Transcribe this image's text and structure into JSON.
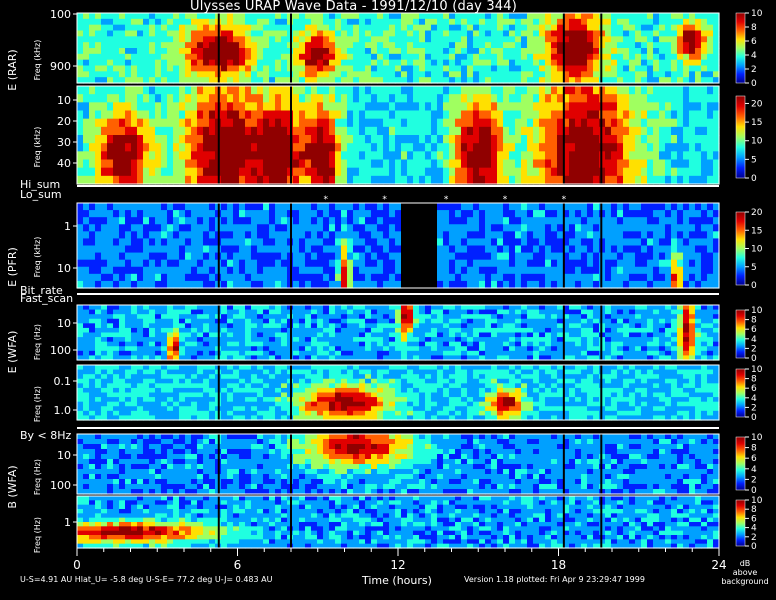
{
  "title": "Ulysses URAP Wave Data - 1991/12/10  (day 344)",
  "x_axis": {
    "label": "Time (hours)",
    "range": [
      0,
      24
    ],
    "ticks": [
      "0",
      "6",
      "12",
      "18",
      "24"
    ]
  },
  "footer": {
    "left": "U-S=4.91 AU  Hlat_U= -5.8 deg  U-S-E= 77.2 deg  U-J= 0.483 AU",
    "right": "Version 1.18 plotted: Fri Apr  9 23:29:47 1999",
    "colorbar_unit": [
      "dB",
      "above",
      "background"
    ]
  },
  "colors": {
    "background": "#000000",
    "text": "#ffffff",
    "colormap": [
      "#00008f",
      "#0020ff",
      "#00a0ff",
      "#20ffe0",
      "#a0ff60",
      "#ffe000",
      "#ff6000",
      "#e00000",
      "#900000"
    ]
  },
  "chart_data": [
    {
      "type": "heatmap",
      "panel": "E (RAR)",
      "ylabel": "E (RAR)",
      "yunit": "Freq (kHz)",
      "yticks": [
        "100",
        "900"
      ],
      "yscale": "log",
      "colorbar_ticks": [
        "0",
        "2",
        "4",
        "6",
        "8",
        "10"
      ],
      "colorbar_range": [
        0,
        10
      ]
    },
    {
      "type": "heatmap",
      "panel": "E (RAR) low band",
      "yunit": "Freq (kHz)",
      "yticks": [
        "10",
        "20",
        "30",
        "40"
      ],
      "yscale": "linear",
      "colorbar_ticks": [
        "0",
        "5",
        "10",
        "15",
        "20"
      ],
      "colorbar_range": [
        0,
        22
      ]
    },
    {
      "type": "heatmap",
      "panel": "E (PFR)",
      "ylabel": "E (PFR)",
      "yunit": "Freq (kHz)",
      "yticks": [
        "1",
        "10"
      ],
      "yscale": "log",
      "colorbar_ticks": [
        "0",
        "5",
        "10",
        "15",
        "20"
      ],
      "colorbar_range": [
        0,
        20
      ]
    },
    {
      "type": "heatmap",
      "panel": "E (WFA) high",
      "ylabel": "E (WFA)",
      "yunit": "Freq (Hz)",
      "yticks": [
        "10",
        "100"
      ],
      "yscale": "log",
      "colorbar_ticks": [
        "0",
        "2",
        "4",
        "6",
        "8",
        "10"
      ],
      "colorbar_range": [
        0,
        10
      ]
    },
    {
      "type": "heatmap",
      "panel": "E (WFA) low",
      "yunit": "Freq (Hz)",
      "yticks": [
        "0.1",
        "1.0"
      ],
      "yscale": "log",
      "colorbar_ticks": [
        "0",
        "2",
        "4",
        "6",
        "8",
        "10"
      ],
      "colorbar_range": [
        0,
        10
      ]
    },
    {
      "type": "heatmap",
      "panel": "B (WFA) high",
      "ylabel": "B (WFA)",
      "yunit": "Freq (Hz)",
      "yticks": [
        "10",
        "100"
      ],
      "yscale": "log",
      "colorbar_ticks": [
        "0",
        "2",
        "4",
        "6",
        "8",
        "10"
      ],
      "colorbar_range": [
        0,
        10
      ]
    },
    {
      "type": "heatmap",
      "panel": "B (WFA) low",
      "yunit": "Freq (Hz)",
      "yticks": [
        "1"
      ],
      "yscale": "log",
      "colorbar_ticks": [
        "0",
        "2",
        "4",
        "6",
        "8",
        "10"
      ],
      "colorbar_range": [
        0,
        10
      ]
    }
  ],
  "flag_rows": {
    "hi_lo": [
      "Hi_sum",
      "Lo_sum"
    ],
    "bit_fast": [
      "Bit_rate",
      "Fast_scan"
    ],
    "by": [
      "By < 8Hz"
    ]
  },
  "intense_bursts_hours": [
    5.3,
    8.0,
    18.2,
    19.6
  ],
  "data_gap_hours": [
    12.2,
    13.5
  ]
}
